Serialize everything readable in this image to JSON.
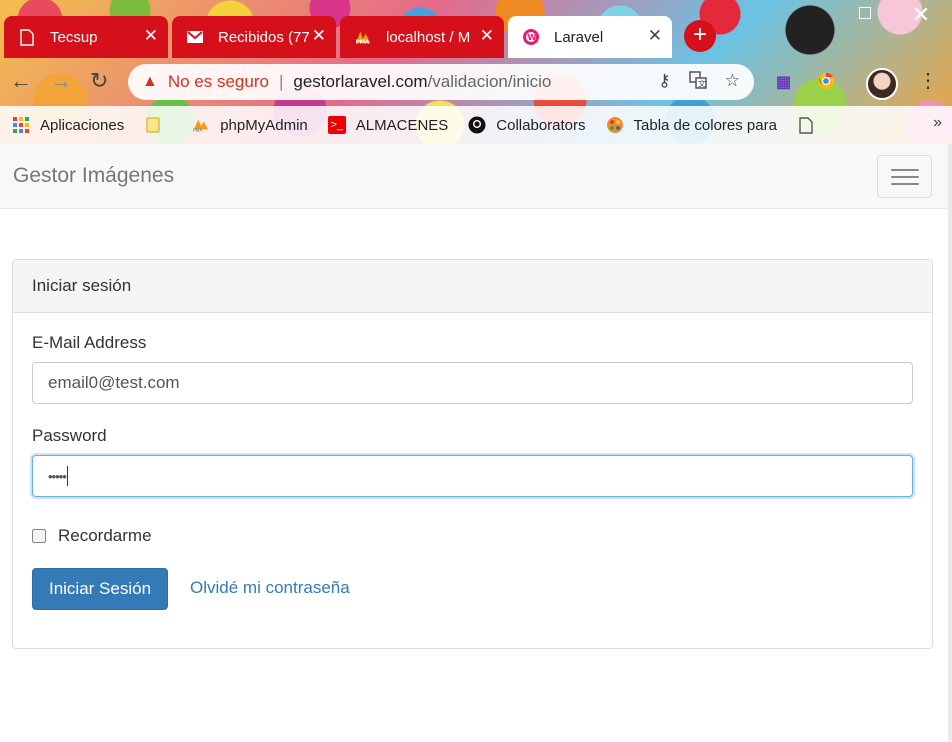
{
  "browser": {
    "tabs": [
      {
        "title": "Tecsup",
        "icon": "document-icon",
        "active": false
      },
      {
        "title": "Recibidos (77",
        "icon": "gmail-icon",
        "active": false
      },
      {
        "title": "localhost / M",
        "icon": "phpmyadmin-icon",
        "active": false
      },
      {
        "title": "Laravel",
        "icon": "laravel-icon",
        "active": true
      }
    ],
    "omnibox": {
      "security_text": "No es seguro",
      "host": "gestorlaravel.com",
      "path": "/validacion/inicio"
    },
    "bookmarks": [
      {
        "label": "Aplicaciones",
        "icon": "apps-grid-icon"
      },
      {
        "label": "",
        "icon": "folder-icon"
      },
      {
        "label": "phpMyAdmin",
        "icon": "phpmyadmin-icon"
      },
      {
        "label": "ALMACENES",
        "icon": "terminal-icon"
      },
      {
        "label": "Collaborators",
        "icon": "github-icon"
      },
      {
        "label": "Tabla de colores para",
        "icon": "palette-icon"
      },
      {
        "label": "",
        "icon": "document-icon"
      }
    ],
    "bookmarks_overflow": "»"
  },
  "navbar": {
    "brand": "Gestor Imágenes"
  },
  "login": {
    "heading": "Iniciar sesión",
    "email_label": "E-Mail Address",
    "email_value": "email0@test.com",
    "password_label": "Password",
    "password_mask": "•••••",
    "remember_label": "Recordarme",
    "remember_checked": false,
    "submit_label": "Iniciar Sesión",
    "forgot_label": "Olvidé mi contraseña"
  },
  "colors": {
    "tab_red": "#d6101a",
    "primary": "#337ab7",
    "warning_red": "#d93025"
  }
}
